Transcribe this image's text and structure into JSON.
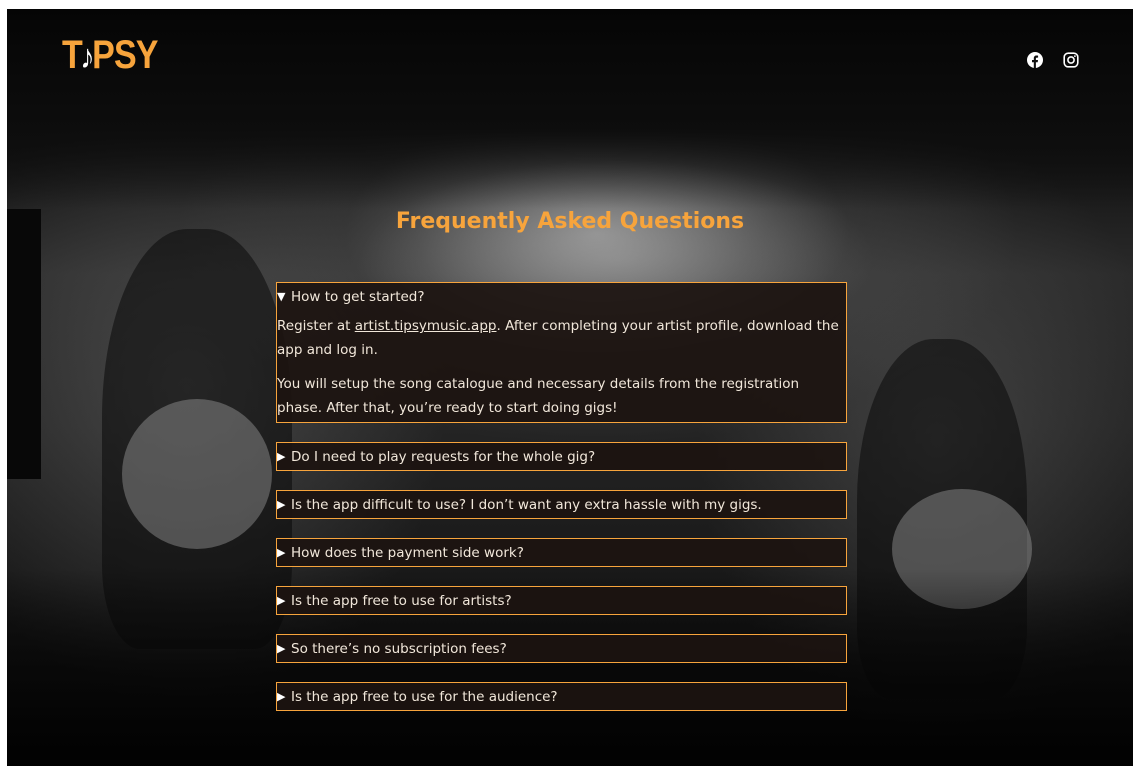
{
  "header": {
    "logo_left": "T",
    "logo_note": "♪",
    "logo_right": "PSY",
    "social": {
      "facebook_icon": "facebook-icon",
      "instagram_icon": "instagram-icon"
    }
  },
  "faq": {
    "title": "Frequently Asked Questions",
    "expanded_marker": "▼",
    "collapsed_marker": "▶",
    "open_item": {
      "question": "How to get started?",
      "answer_p1_pre": "Register at ",
      "answer_p1_link": "artist.tipsymusic.app",
      "answer_p1_post": ". After completing your artist profile, download the app and log in.",
      "answer_p2": "You will setup the song catalogue and necessary details from the registration phase. After that, you’re ready to start doing gigs!"
    },
    "items": [
      {
        "question": "Do I need to play requests for the whole gig?"
      },
      {
        "question": "Is the app difficult to use? I don’t want any extra hassle with my gigs."
      },
      {
        "question": "How does the payment side work?"
      },
      {
        "question": "Is the app free to use for artists?"
      },
      {
        "question": "So there’s no subscription fees?"
      },
      {
        "question": "Is the app free to use for the audience?"
      }
    ]
  },
  "colors": {
    "accent": "#f7a43c",
    "panel": "#1c1410",
    "text": "#f1e7da"
  }
}
